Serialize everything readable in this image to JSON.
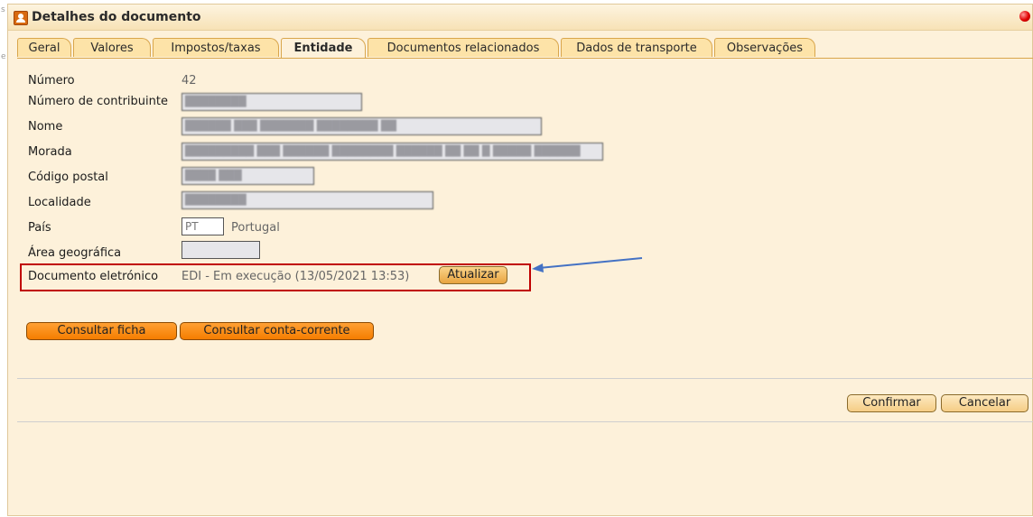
{
  "window": {
    "title": "Detalhes do documento"
  },
  "tabs": [
    {
      "label": "Geral"
    },
    {
      "label": "Valores"
    },
    {
      "label": "Impostos/taxas"
    },
    {
      "label": "Entidade"
    },
    {
      "label": "Documentos relacionados"
    },
    {
      "label": "Dados de transporte"
    },
    {
      "label": "Observações"
    }
  ],
  "form": {
    "numero": {
      "label": "Número",
      "value": "42"
    },
    "contribuinte": {
      "label": "Número de contribuinte",
      "value": "████████"
    },
    "nome": {
      "label": "Nome",
      "value": "██████ ███ ███████ ████████ ██"
    },
    "morada": {
      "label": "Morada",
      "value": "█████████ ███ ██████ ████████ ██████ ██ ██ █ █████ ██████"
    },
    "codigo_postal": {
      "label": "Código postal",
      "value": "████ ███"
    },
    "localidade": {
      "label": "Localidade",
      "value": "████████"
    },
    "pais": {
      "label": "País",
      "code": "PT",
      "name": "Portugal"
    },
    "area": {
      "label": "Área geográfica",
      "value": ""
    },
    "doc_eletronico": {
      "label": "Documento eletrónico",
      "status": "EDI - Em execução (13/05/2021 13:53)",
      "button": "Atualizar"
    }
  },
  "actions": {
    "consultar_ficha": "Consultar ficha",
    "consultar_conta": "Consultar conta-corrente",
    "confirmar": "Confirmar",
    "cancelar": "Cancelar"
  }
}
